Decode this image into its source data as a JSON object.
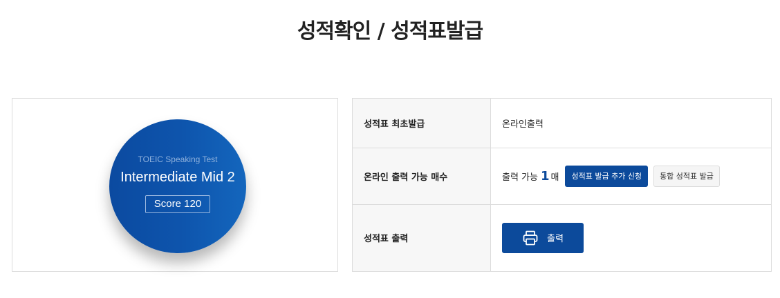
{
  "page": {
    "title": "성적확인 / 성적표발급"
  },
  "score_card": {
    "test_name": "TOEIC Speaking Test",
    "level": "Intermediate Mid 2",
    "score": "Score 120"
  },
  "info_table": {
    "rows": [
      {
        "label": "성적표 최초발급",
        "value": "온라인출력"
      },
      {
        "label": "온라인 출력 가능 매수"
      },
      {
        "label": "성적표 출력"
      }
    ],
    "print_count": {
      "prefix": "출력 가능",
      "count": "1",
      "unit": "매"
    },
    "buttons": {
      "add_request": "성적표 발급 추가 신청",
      "integrated": "통합 성적표 발급",
      "print": "출력"
    }
  },
  "colors": {
    "accent": "#0c4a9b",
    "circle_start": "#0b4aa0",
    "circle_end": "#1466bd"
  },
  "icons": {
    "print": "printer-icon"
  }
}
